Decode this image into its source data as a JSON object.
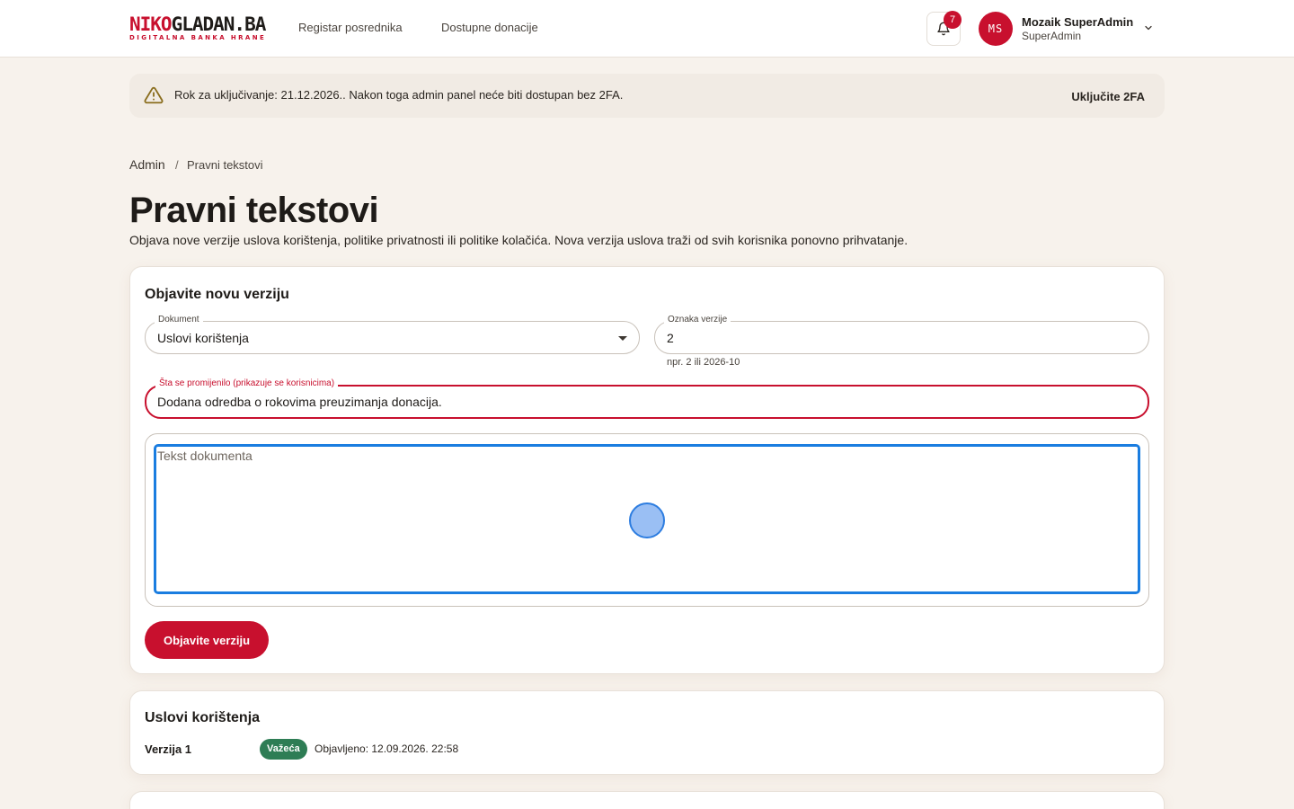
{
  "header": {
    "logo": {
      "part1": "NIKO",
      "part2": "GLADAN.BA",
      "tagline": "DIGITALNA BANKA HRANE"
    },
    "nav": [
      {
        "label": "Registar posrednika"
      },
      {
        "label": "Dostupne donacije"
      }
    ],
    "notifications": {
      "count": "7",
      "icon": "bell-icon"
    },
    "user": {
      "initials": "MS",
      "name": "Mozaik SuperAdmin",
      "role": "SuperAdmin"
    }
  },
  "banner": {
    "text": "Rok za uključivanje: 21.12.2026.. Nakon toga admin panel neće biti dostupan bez 2FA.",
    "action": "Uključite 2FA",
    "icon": "warning-icon"
  },
  "breadcrumb": {
    "root": "Admin",
    "separator": "/",
    "current": "Pravni tekstovi"
  },
  "page": {
    "title": "Pravni tekstovi",
    "description": "Objava nove verzije uslova korištenja, politike privatnosti ili politike kolačića. Nova verzija uslova traži od svih korisnika ponovno prihvatanje."
  },
  "form": {
    "title": "Objavite novu verziju",
    "document": {
      "label": "Dokument",
      "value": "Uslovi korištenja"
    },
    "version": {
      "label": "Oznaka verzije",
      "value": "2",
      "helper": "npr. 2 ili 2026-10"
    },
    "changes": {
      "label": "Šta se promijenilo (prikazuje se korisnicima)",
      "value": "Dodana odredba o rokovima preuzimanja donacija."
    },
    "editor": {
      "placeholder": "Tekst dokumenta"
    },
    "submit": "Objavite verziju"
  },
  "versions_card": {
    "title": "Uslovi korištenja",
    "rows": [
      {
        "version": "Verzija 1",
        "status": "Važeća",
        "published": "Objavljeno: 12.09.2026. 22:58"
      }
    ]
  },
  "colors": {
    "brand": "#c8102e",
    "success": "#2e7d55",
    "focus": "#1a7de0",
    "background": "#f7f2ec"
  }
}
